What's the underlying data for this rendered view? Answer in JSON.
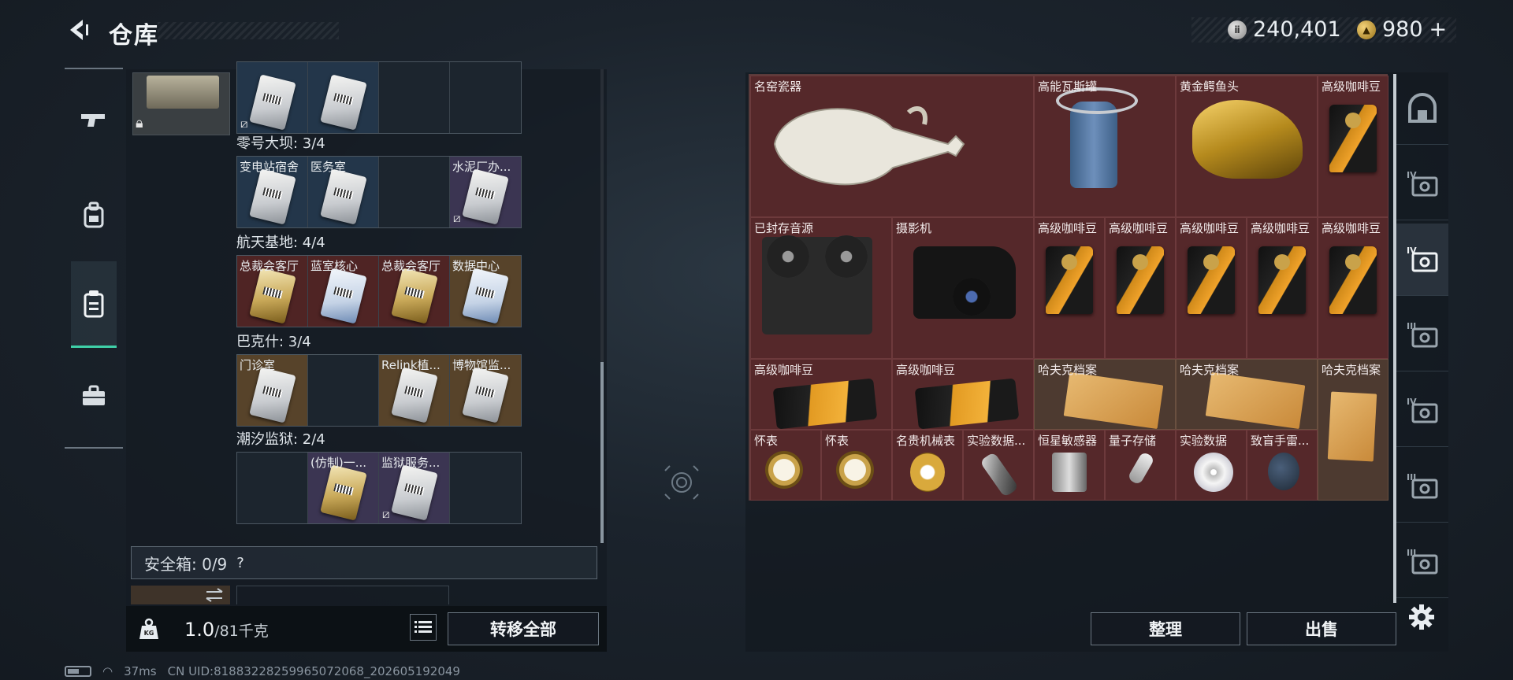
{
  "header": {
    "title": "仓库",
    "silver_amount": "240,401",
    "gold_amount": "980",
    "gold_plus": "+"
  },
  "left_tabs": [
    "gun-icon",
    "backpack-icon",
    "storage-icon",
    "toolbox-icon"
  ],
  "keycard_groups": [
    {
      "title": "",
      "cells": [
        {
          "label": "",
          "color": "blue",
          "card": "silver",
          "unbound": true
        },
        {
          "label": "",
          "color": "blue",
          "card": "silver",
          "unbound": false
        },
        {
          "label": "",
          "color": "dark",
          "card": "",
          "unbound": false
        },
        {
          "label": "",
          "color": "dark",
          "card": "",
          "unbound": false
        }
      ]
    },
    {
      "title": "零号大坝: 3/4",
      "cells": [
        {
          "label": "变电站宿舍",
          "color": "blue",
          "card": "silver",
          "unbound": false
        },
        {
          "label": "医务室",
          "color": "blue",
          "card": "silver",
          "unbound": false
        },
        {
          "label": "",
          "color": "dark",
          "card": "",
          "unbound": false
        },
        {
          "label": "水泥厂办...",
          "color": "purple",
          "card": "silver",
          "unbound": true
        }
      ]
    },
    {
      "title": "航天基地: 4/4",
      "cells": [
        {
          "label": "总裁会客厅",
          "color": "red",
          "card": "gold",
          "unbound": false
        },
        {
          "label": "蓝室核心",
          "color": "red",
          "card": "blue",
          "unbound": false
        },
        {
          "label": "总裁会客厅",
          "color": "red",
          "card": "gold",
          "unbound": false
        },
        {
          "label": "数据中心",
          "color": "gold",
          "card": "blue",
          "unbound": false
        }
      ]
    },
    {
      "title": "巴克什: 3/4",
      "cells": [
        {
          "label": "门诊室",
          "color": "gold",
          "card": "silver",
          "unbound": false
        },
        {
          "label": "",
          "color": "dark",
          "card": "",
          "unbound": false
        },
        {
          "label": "Relink植...",
          "color": "gold",
          "card": "silver",
          "unbound": false
        },
        {
          "label": "博物馆监...",
          "color": "gold",
          "card": "silver",
          "unbound": false
        }
      ]
    },
    {
      "title": "潮汐监狱: 2/4",
      "cells": [
        {
          "label": "",
          "color": "dark",
          "card": "",
          "unbound": false
        },
        {
          "label": "(仿制)一...",
          "color": "purple",
          "card": "gold",
          "unbound": false
        },
        {
          "label": "监狱服务...",
          "color": "purple",
          "card": "silver",
          "unbound": true
        },
        {
          "label": "",
          "color": "dark",
          "card": "",
          "unbound": false
        }
      ]
    }
  ],
  "safe_box": {
    "label": "安全箱: 0/9",
    "help": "?"
  },
  "weight": {
    "current": "1.0",
    "max": "/81千克"
  },
  "buttons": {
    "transfer_all": "转移全部",
    "organize": "整理",
    "sell": "出售"
  },
  "stash_items": [
    {
      "name": "名窑瓷器",
      "pic": "vase"
    },
    {
      "name": "高能瓦斯罐",
      "pic": "canister"
    },
    {
      "name": "黄金鳄鱼头",
      "pic": "croc"
    },
    {
      "name": "高级咖啡豆",
      "pic": "bag"
    },
    {
      "name": "已封存音源",
      "pic": "reel"
    },
    {
      "name": "摄影机",
      "pic": "camera"
    },
    {
      "name": "高级咖啡豆",
      "pic": "bag"
    },
    {
      "name": "高级咖啡豆",
      "pic": "bag"
    },
    {
      "name": "高级咖啡豆",
      "pic": "bag"
    },
    {
      "name": "高级咖啡豆",
      "pic": "bag"
    },
    {
      "name": "高级咖啡豆",
      "pic": "bag"
    },
    {
      "name": "高级咖啡豆",
      "pic": "bag-flat"
    },
    {
      "name": "高级咖啡豆",
      "pic": "bag-flat"
    },
    {
      "name": "哈夫克档案",
      "pic": "file"
    },
    {
      "name": "哈夫克档案",
      "pic": "file"
    },
    {
      "name": "哈夫克档案",
      "pic": "file tall"
    },
    {
      "name": "怀表",
      "pic": "watch"
    },
    {
      "name": "怀表",
      "pic": "watch"
    },
    {
      "name": "名贵机械表",
      "pic": "small-obj gold-watch"
    },
    {
      "name": "实验数据...",
      "pic": "small-obj silver"
    },
    {
      "name": "恒星敏感器",
      "pic": "small-obj sensor"
    },
    {
      "name": "量子存储",
      "pic": "small-obj usb"
    },
    {
      "name": "实验数据",
      "pic": "small-obj disc"
    },
    {
      "name": "致盲手雷...",
      "pic": "small-obj grenade"
    }
  ],
  "right_tabs": [
    "bunker-icon",
    "tier-iv-storage-icon",
    "tier-iv-storage-active-icon",
    "tier-iii-storage-icon",
    "tier-iv-folder-icon",
    "tier-iii-box-icon",
    "tier-iii-box-icon-2"
  ],
  "right_tab_tiers": [
    "",
    "IV",
    "IV",
    "III",
    "IV",
    "III",
    "III"
  ],
  "status": {
    "ping": "37ms",
    "uid": "CN UID:81883228259965072068_202605192049"
  },
  "colors": {
    "accent_green": "#3fd0a8",
    "stash_red": "#55282a"
  }
}
